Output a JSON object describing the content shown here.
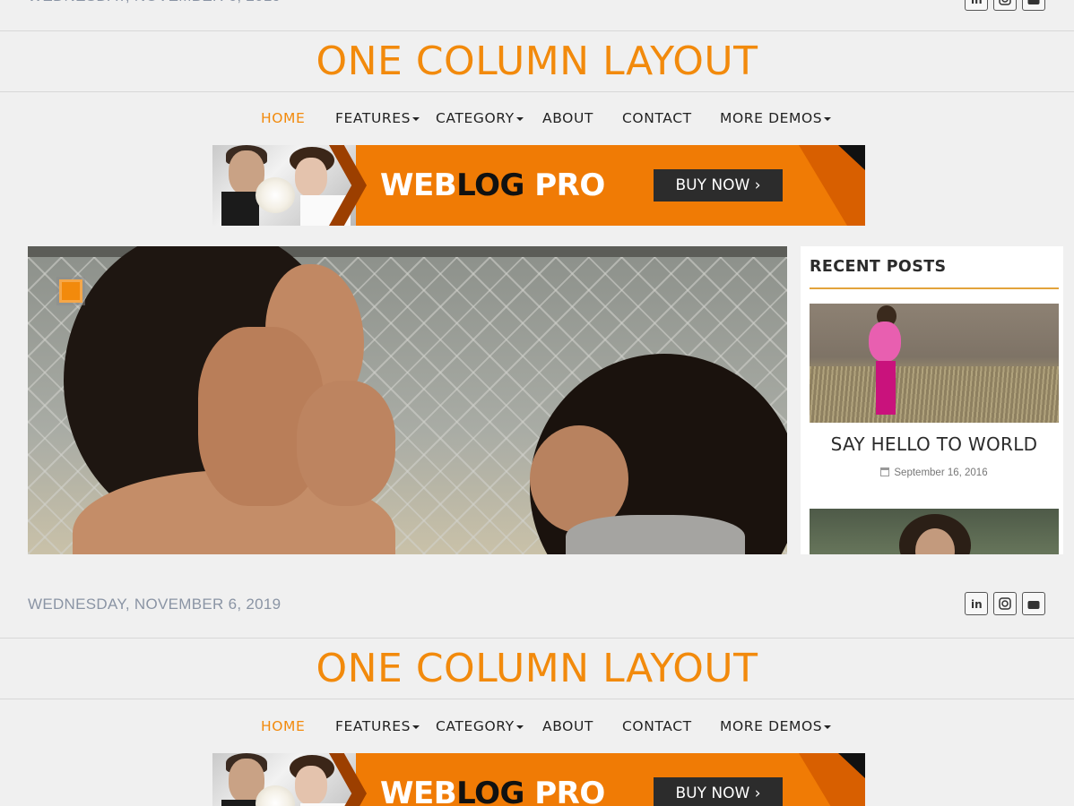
{
  "header": {
    "date": "WEDNESDAY, NOVEMBER 6, 2019",
    "site_title": "ONE COLUMN LAYOUT",
    "social": [
      "linkedin-icon",
      "instagram-icon",
      "youtube-icon"
    ]
  },
  "nav": {
    "items": [
      {
        "label": "HOME",
        "active": true
      },
      {
        "label": "FEATURES",
        "dropdown": true
      },
      {
        "label": "CATEGORY",
        "dropdown": true
      },
      {
        "label": "ABOUT"
      },
      {
        "label": "CONTACT"
      },
      {
        "label": "MORE DEMOS",
        "dropdown": true
      }
    ]
  },
  "banner": {
    "brand_a": "WEB",
    "brand_b": "LOG",
    "brand_c": " PRO",
    "cta": "BUY NOW"
  },
  "sidebar": {
    "widget_title": "RECENT POSTS",
    "posts": [
      {
        "title": "SAY HELLO TO WORLD",
        "date": "September 16, 2016"
      }
    ]
  },
  "colors": {
    "accent": "#f28a0c",
    "banner": "#f07b05",
    "rule": "#e2a33b"
  }
}
